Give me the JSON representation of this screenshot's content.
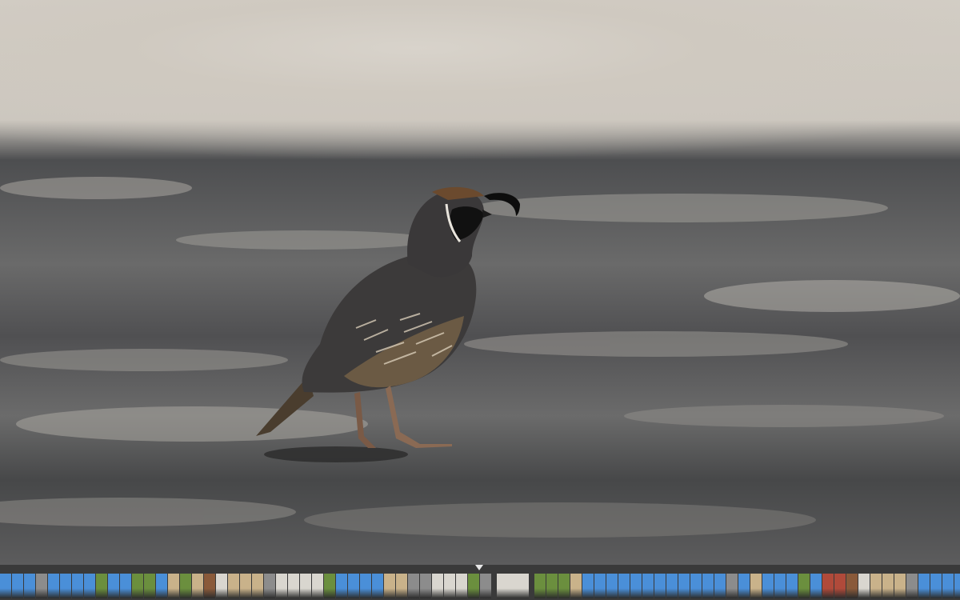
{
  "viewer": {
    "photo_subject": "quail",
    "icons": {
      "current_marker": "triangle-down-icon"
    }
  },
  "filmstrip": {
    "selected_index": 41,
    "colors": {
      "sky": "#4a8fd8",
      "green": "#6b8f3e",
      "tan": "#c9b28a",
      "gray": "#8c8c8c",
      "pale": "#d9d6cf",
      "brown": "#8a5a3a",
      "red": "#b04a3a"
    },
    "thumbnails": [
      "sky",
      "sky",
      "sky",
      "gray",
      "sky",
      "sky",
      "sky",
      "sky",
      "green",
      "sky",
      "sky",
      "green",
      "green",
      "sky",
      "tan",
      "green",
      "tan",
      "brown",
      "pale",
      "tan",
      "tan",
      "tan",
      "gray",
      "pale",
      "pale",
      "pale",
      "pale",
      "green",
      "sky",
      "sky",
      "sky",
      "sky",
      "tan",
      "tan",
      "gray",
      "gray",
      "pale",
      "pale",
      "pale",
      "green",
      "gray",
      "pale",
      "green",
      "green",
      "green",
      "tan",
      "sky",
      "sky",
      "sky",
      "sky",
      "sky",
      "sky",
      "sky",
      "sky",
      "sky",
      "sky",
      "sky",
      "sky",
      "gray",
      "sky",
      "tan",
      "sky",
      "sky",
      "sky",
      "green",
      "sky",
      "red",
      "red",
      "brown",
      "pale",
      "tan",
      "tan",
      "tan",
      "gray",
      "sky",
      "sky",
      "sky",
      "sky",
      "sky",
      "sky",
      "tan",
      "sky",
      "sky",
      "sky"
    ]
  }
}
